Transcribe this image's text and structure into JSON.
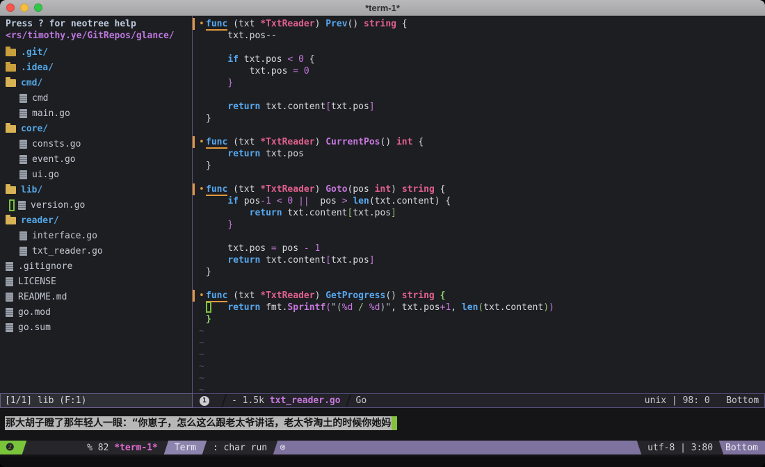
{
  "window": {
    "title": "*term-1*"
  },
  "colors": {
    "accent_blue": "#57a8ef",
    "accent_pink": "#e0608c",
    "accent_violet": "#c678dd",
    "accent_green": "#98c379",
    "accent_orange": "#e2983c",
    "tab_green": "#7ac43c",
    "bar_purple": "#7d739e",
    "buffer_magenta": "#e06ad2",
    "folder_gold": "#d8b254"
  },
  "neotree": {
    "help": "Press ? for neotree help",
    "root_path": "<rs/timothy.ye/GitRepos/glance/",
    "items": [
      {
        "name": ".git/",
        "type": "folder-closed",
        "indent": 0,
        "cursor": false
      },
      {
        "name": ".idea/",
        "type": "folder-closed",
        "indent": 0,
        "cursor": false
      },
      {
        "name": "cmd/",
        "type": "folder-open",
        "indent": 0,
        "cursor": false
      },
      {
        "name": "cmd",
        "type": "file",
        "indent": 1,
        "cursor": false
      },
      {
        "name": "main.go",
        "type": "file",
        "indent": 1,
        "cursor": false
      },
      {
        "name": "core/",
        "type": "folder-open",
        "indent": 0,
        "cursor": false
      },
      {
        "name": "consts.go",
        "type": "file",
        "indent": 1,
        "cursor": false
      },
      {
        "name": "event.go",
        "type": "file",
        "indent": 1,
        "cursor": false
      },
      {
        "name": "ui.go",
        "type": "file",
        "indent": 1,
        "cursor": false
      },
      {
        "name": "lib/",
        "type": "folder-open",
        "indent": 0,
        "cursor": false
      },
      {
        "name": "version.go",
        "type": "file",
        "indent": 1,
        "cursor": true
      },
      {
        "name": "reader/",
        "type": "folder-open",
        "indent": 0,
        "cursor": false
      },
      {
        "name": "interface.go",
        "type": "file",
        "indent": 1,
        "cursor": false
      },
      {
        "name": "txt_reader.go",
        "type": "file",
        "indent": 1,
        "cursor": false
      },
      {
        "name": ".gitignore",
        "type": "file",
        "indent": 0,
        "cursor": false
      },
      {
        "name": "LICENSE",
        "type": "file",
        "indent": 0,
        "cursor": false
      },
      {
        "name": "README.md",
        "type": "file",
        "indent": 0,
        "cursor": false
      },
      {
        "name": "go.mod",
        "type": "file",
        "indent": 0,
        "cursor": false
      },
      {
        "name": "go.sum",
        "type": "file",
        "indent": 0,
        "cursor": false
      }
    ]
  },
  "editor": {
    "bullet": "•",
    "tilde_char": "~",
    "tilde_count": 6,
    "code_lines": [
      {
        "bullet": true,
        "spans": [
          [
            "k ul",
            "func"
          ],
          [
            "w",
            " ("
          ],
          [
            "w",
            "txt "
          ],
          [
            "p",
            "*TxtReader"
          ],
          [
            "w",
            ") "
          ],
          [
            "k",
            "Prev"
          ],
          [
            "w",
            "() "
          ],
          [
            "p",
            "string"
          ],
          [
            "w",
            " {"
          ]
        ]
      },
      {
        "spans": [
          [
            "w",
            "    txt.pos--"
          ]
        ]
      },
      {
        "spans": []
      },
      {
        "spans": [
          [
            "w",
            "    "
          ],
          [
            "k",
            "if"
          ],
          [
            "w",
            " txt.pos "
          ],
          [
            "v",
            "<"
          ],
          [
            "w",
            " "
          ],
          [
            "v",
            "0"
          ],
          [
            "w",
            " {"
          ]
        ]
      },
      {
        "spans": [
          [
            "w",
            "        txt.pos "
          ],
          [
            "v",
            "="
          ],
          [
            "w",
            " "
          ],
          [
            "v",
            "0"
          ]
        ]
      },
      {
        "spans": [
          [
            "w",
            "    "
          ],
          [
            "v",
            "}"
          ]
        ]
      },
      {
        "spans": []
      },
      {
        "spans": [
          [
            "w",
            "    "
          ],
          [
            "k",
            "return"
          ],
          [
            "w",
            " txt.content"
          ],
          [
            "v",
            "["
          ],
          [
            "w",
            "txt.pos"
          ],
          [
            "v",
            "]"
          ]
        ]
      },
      {
        "spans": [
          [
            "w",
            "}"
          ]
        ]
      },
      {
        "spans": []
      },
      {
        "bullet": true,
        "spans": [
          [
            "k ul",
            "func"
          ],
          [
            "w",
            " ("
          ],
          [
            "w",
            "txt "
          ],
          [
            "p",
            "*TxtReader"
          ],
          [
            "w",
            ") "
          ],
          [
            "vb",
            "CurrentPos"
          ],
          [
            "w",
            "() "
          ],
          [
            "p",
            "int"
          ],
          [
            "w",
            " {"
          ]
        ]
      },
      {
        "spans": [
          [
            "w",
            "    "
          ],
          [
            "k",
            "return"
          ],
          [
            "w",
            " txt.pos"
          ]
        ]
      },
      {
        "spans": [
          [
            "w",
            "}"
          ]
        ]
      },
      {
        "spans": []
      },
      {
        "bullet": true,
        "spans": [
          [
            "k ul",
            "func"
          ],
          [
            "w",
            " ("
          ],
          [
            "w",
            "txt "
          ],
          [
            "p",
            "*TxtReader"
          ],
          [
            "w",
            ") "
          ],
          [
            "vb",
            "Goto"
          ],
          [
            "w",
            "("
          ],
          [
            "w",
            "pos "
          ],
          [
            "p",
            "int"
          ],
          [
            "w",
            ") "
          ],
          [
            "p",
            "string"
          ],
          [
            "w",
            " {"
          ]
        ]
      },
      {
        "spans": [
          [
            "w",
            "    "
          ],
          [
            "k",
            "if"
          ],
          [
            "w",
            " pos"
          ],
          [
            "v",
            "-"
          ],
          [
            "v",
            "1"
          ],
          [
            "w",
            " "
          ],
          [
            "v",
            "<"
          ],
          [
            "w",
            " "
          ],
          [
            "v",
            "0"
          ],
          [
            "w",
            " "
          ],
          [
            "v",
            "||"
          ],
          [
            "w",
            "  pos "
          ],
          [
            "v",
            ">"
          ],
          [
            "w",
            " "
          ],
          [
            "k",
            "len"
          ],
          [
            "w",
            "(txt.content) {"
          ]
        ]
      },
      {
        "spans": [
          [
            "w",
            "        "
          ],
          [
            "k",
            "return"
          ],
          [
            "w",
            " txt.content"
          ],
          [
            "g",
            "["
          ],
          [
            "w",
            "txt.pos"
          ],
          [
            "g",
            "]"
          ]
        ]
      },
      {
        "spans": [
          [
            "w",
            "    "
          ],
          [
            "v",
            "}"
          ]
        ]
      },
      {
        "spans": []
      },
      {
        "spans": [
          [
            "w",
            "    txt.pos "
          ],
          [
            "v",
            "="
          ],
          [
            "w",
            " pos "
          ],
          [
            "v",
            "-"
          ],
          [
            "w",
            " "
          ],
          [
            "v",
            "1"
          ]
        ]
      },
      {
        "spans": [
          [
            "w",
            "    "
          ],
          [
            "k",
            "return"
          ],
          [
            "w",
            " txt.content"
          ],
          [
            "v",
            "["
          ],
          [
            "w",
            "txt.pos"
          ],
          [
            "v",
            "]"
          ]
        ]
      },
      {
        "spans": [
          [
            "w",
            "}"
          ]
        ]
      },
      {
        "spans": []
      },
      {
        "bullet": true,
        "spans": [
          [
            "k ul",
            "func"
          ],
          [
            "w",
            " ("
          ],
          [
            "w",
            "txt "
          ],
          [
            "p",
            "*TxtReader"
          ],
          [
            "w",
            ") "
          ],
          [
            "k",
            "GetProgress"
          ],
          [
            "w",
            "() "
          ],
          [
            "p",
            "string"
          ],
          [
            "w",
            " "
          ],
          [
            "gb",
            "{"
          ]
        ]
      },
      {
        "cursor": true,
        "spans": [
          [
            "w",
            "    "
          ],
          [
            "k",
            "return"
          ],
          [
            "w",
            " fmt."
          ],
          [
            "vb",
            "Sprintf"
          ],
          [
            "v",
            "("
          ],
          [
            "d",
            "\"("
          ],
          [
            "v",
            "%d"
          ],
          [
            "g",
            " / "
          ],
          [
            "v",
            "%d"
          ],
          [
            "d",
            ")\""
          ],
          [
            "w",
            ", txt.pos"
          ],
          [
            "v",
            "+"
          ],
          [
            "v",
            "1"
          ],
          [
            "w",
            ", "
          ],
          [
            "k",
            "len"
          ],
          [
            "g",
            "("
          ],
          [
            "w",
            "txt.content"
          ],
          [
            "g",
            ")"
          ],
          [
            "v",
            ")"
          ]
        ]
      },
      {
        "spans": [
          [
            "gb",
            "}"
          ]
        ]
      }
    ]
  },
  "statusline": {
    "neotree_status": "[1/1] lib (F:1)",
    "buffer_badge": "1",
    "file_size": "- 1.5k",
    "filename": "txt_reader.go",
    "filetype": "Go",
    "encoding": "unix",
    "separator": "|",
    "cursor_pos": "98: 0",
    "scroll_pos": "Bottom"
  },
  "terminal": {
    "text": "那大胡子瞪了那年轻人一眼：“你崽子，怎么这么跟老太爷讲话，老太爷淘土的时候你她妈"
  },
  "tabline": {
    "tab_badge": "❷",
    "window_flag": "% 82",
    "buffer_name": "*term-1*",
    "mode": "Term",
    "command": ": char run",
    "close_icon": "⊗",
    "encoding": "utf-8 | 3:80",
    "scroll_pos": "Bottom"
  }
}
